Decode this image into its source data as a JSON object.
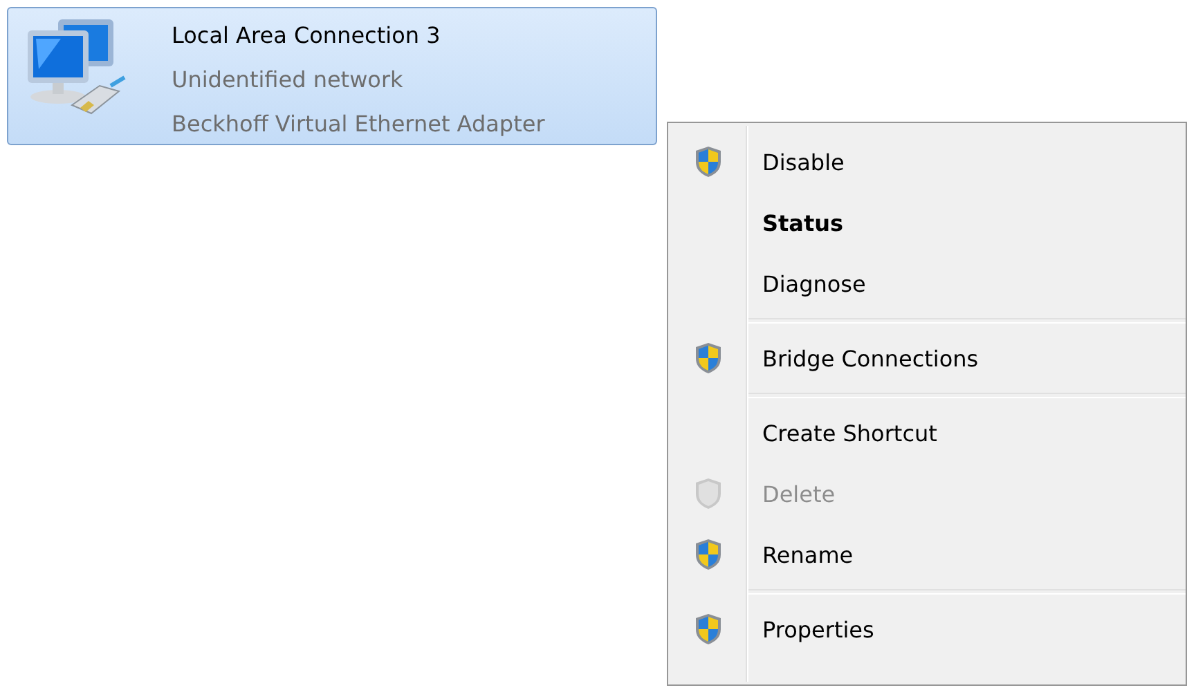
{
  "connection": {
    "name": "Local Area Connection 3",
    "status": "Unidentified network",
    "device": "Beckhoff Virtual Ethernet Adapter",
    "selected": true
  },
  "context_menu": {
    "items": [
      {
        "kind": "item",
        "label": "Disable",
        "shield": true,
        "default": false,
        "disabled": false
      },
      {
        "kind": "item",
        "label": "Status",
        "shield": false,
        "default": true,
        "disabled": false
      },
      {
        "kind": "item",
        "label": "Diagnose",
        "shield": false,
        "default": false,
        "disabled": false
      },
      {
        "kind": "separator"
      },
      {
        "kind": "item",
        "label": "Bridge Connections",
        "shield": true,
        "default": false,
        "disabled": false
      },
      {
        "kind": "separator"
      },
      {
        "kind": "item",
        "label": "Create Shortcut",
        "shield": false,
        "default": false,
        "disabled": false
      },
      {
        "kind": "item",
        "label": "Delete",
        "shield": true,
        "default": false,
        "disabled": true
      },
      {
        "kind": "item",
        "label": "Rename",
        "shield": true,
        "default": false,
        "disabled": false
      },
      {
        "kind": "separator"
      },
      {
        "kind": "item",
        "label": "Properties",
        "shield": true,
        "default": false,
        "disabled": false
      }
    ]
  }
}
